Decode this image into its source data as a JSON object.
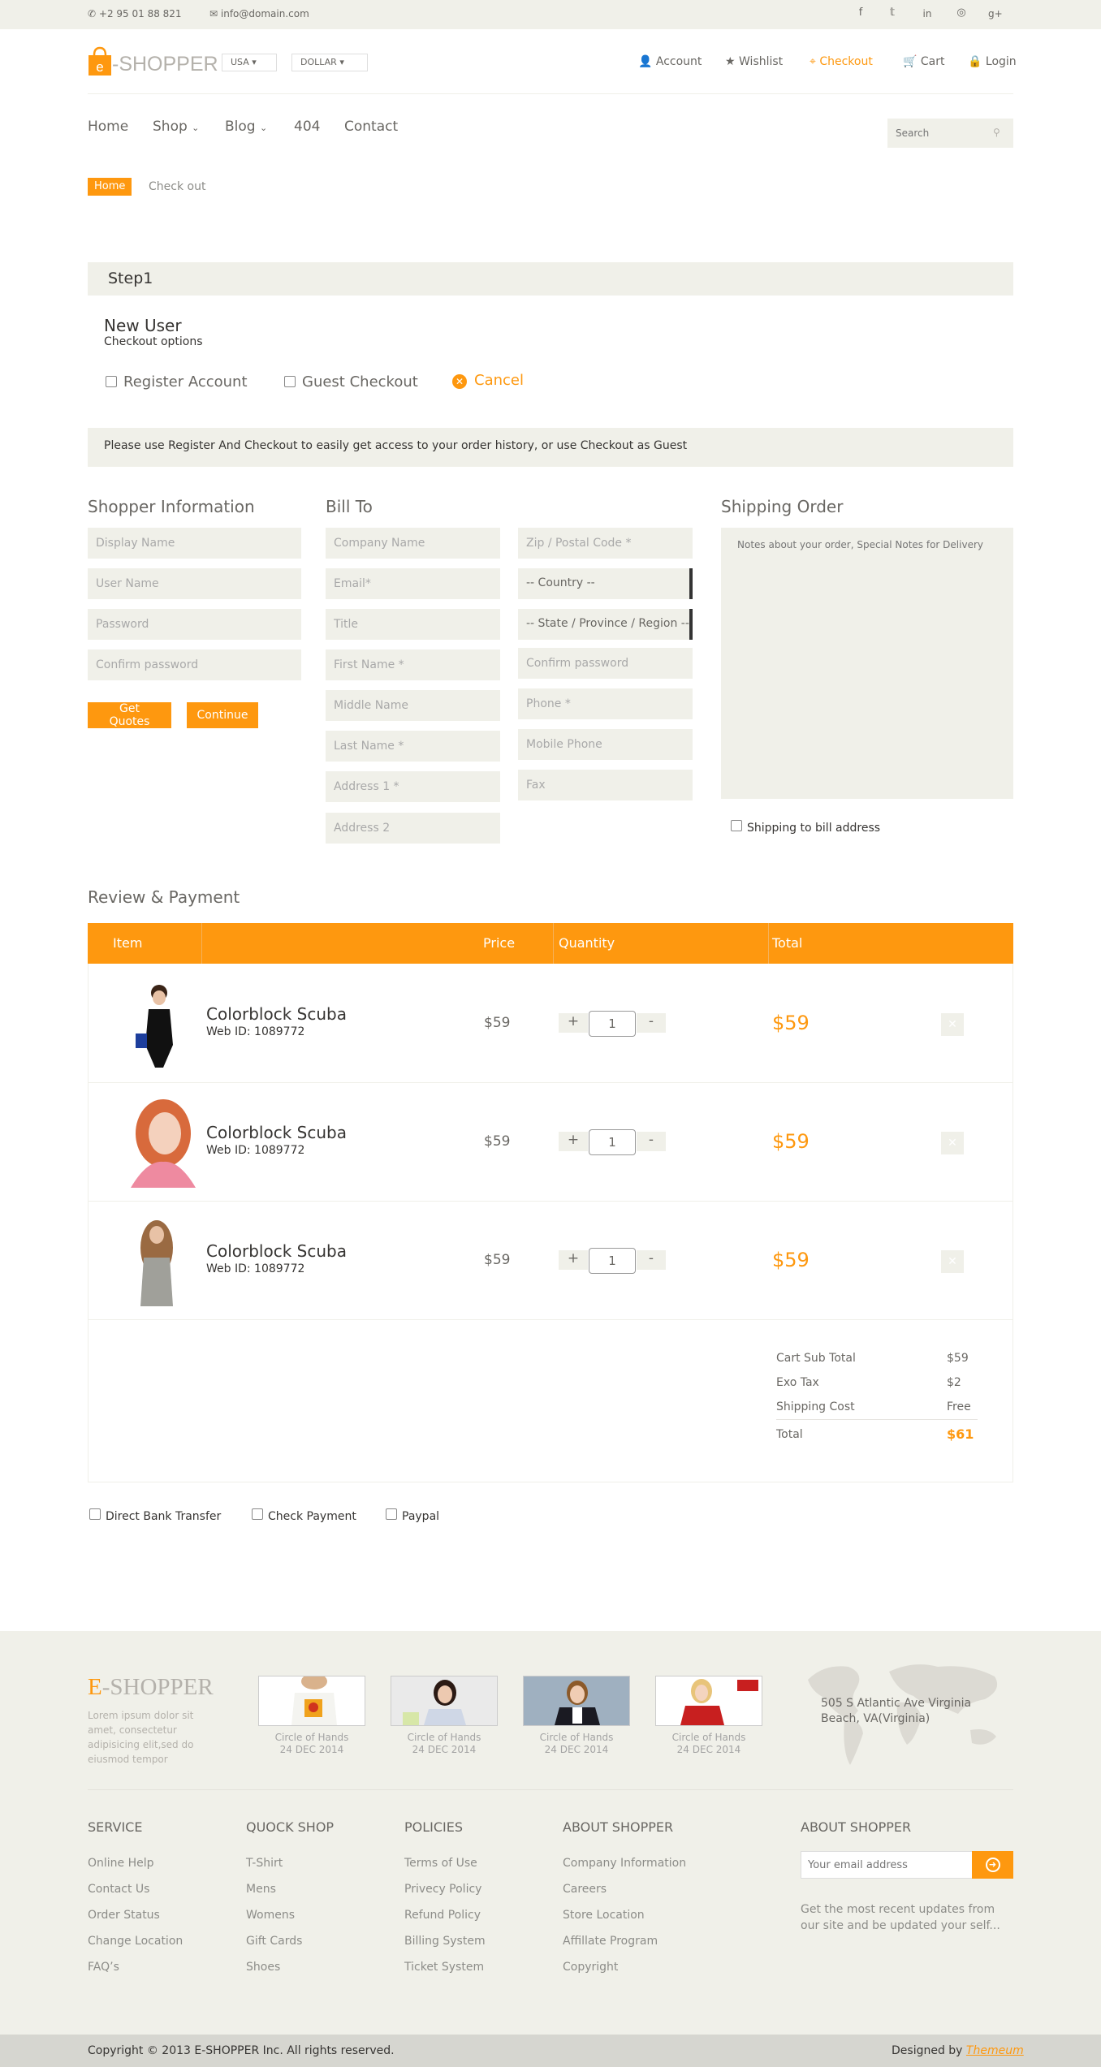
{
  "topbar": {
    "phone": "+2 95 01 88 821",
    "email": "info@domain.com",
    "social": [
      "facebook-icon",
      "twitter-icon",
      "linkedin-icon",
      "dribbble-icon",
      "google-plus-icon"
    ]
  },
  "header": {
    "logo_e": "e",
    "logo_text": "-SHOPPER",
    "country_dropdown": "USA",
    "currency_dropdown": "DOLLAR",
    "nav": [
      "Account",
      "Wishlist",
      "Checkout",
      "Cart",
      "Login"
    ]
  },
  "mainnav": {
    "items": [
      "Home",
      "Shop",
      "Blog",
      "404",
      "Contact"
    ],
    "search_placeholder": "Search"
  },
  "breadcrumb": {
    "home": "Home",
    "current": "Check out"
  },
  "step": {
    "title": "Step1",
    "heading": "New User",
    "sub": "Checkout options",
    "register": "Register Account",
    "guest": "Guest Checkout",
    "cancel": "Cancel"
  },
  "notice": "Please use Register And Checkout to easily get access to your order history, or use Checkout as Guest",
  "shopper": {
    "title": "Shopper Information",
    "fields": [
      "Display Name",
      "User Name",
      "Password",
      "Confirm password"
    ],
    "quotes_btn": "Get Quotes",
    "continue_btn": "Continue"
  },
  "billto": {
    "title": "Bill To",
    "col1": [
      "Company Name",
      "Email*",
      "Title",
      "First Name *",
      "Middle Name",
      "Last Name *",
      "Address 1 *",
      "Address 2"
    ],
    "zip": "Zip / Postal Code *",
    "country": "-- Country --",
    "state": "-- State / Province / Region --",
    "col2": [
      "Confirm password",
      "Phone *",
      "Mobile Phone",
      "Fax"
    ]
  },
  "shipping": {
    "title": "Shipping Order",
    "placeholder": "Notes about your order, Special Notes for Delivery",
    "checkbox": "Shipping to bill address"
  },
  "review": {
    "title": "Review & Payment",
    "headers": [
      "Item",
      "",
      "Price",
      "Quantity",
      "Total"
    ],
    "items": [
      {
        "name": "Colorblock Scuba",
        "web_id": "Web ID: 1089772",
        "price": "$59",
        "qty": "1",
        "total": "$59"
      },
      {
        "name": "Colorblock Scuba",
        "web_id": "Web ID: 1089772",
        "price": "$59",
        "qty": "1",
        "total": "$59"
      },
      {
        "name": "Colorblock Scuba",
        "web_id": "Web ID: 1089772",
        "price": "$59",
        "qty": "1",
        "total": "$59"
      }
    ],
    "plus": "+",
    "minus": "-",
    "summary": [
      {
        "label": "Cart Sub Total",
        "value": "$59"
      },
      {
        "label": "Exo Tax",
        "value": "$2"
      },
      {
        "label": "Shipping Cost",
        "value": "Free"
      },
      {
        "label": "Total",
        "value": "$61"
      }
    ]
  },
  "payment": [
    "Direct Bank Transfer",
    "Check Payment",
    "Paypal"
  ],
  "footer": {
    "logo_e": "E",
    "logo_text": "-SHOPPER",
    "lorem": "Lorem ipsum dolor sit amet, consectetur adipisicing elit,sed do eiusmod tempor",
    "videos": [
      {
        "cap": "Circle of Hands",
        "date": "24 DEC 2014"
      },
      {
        "cap": "Circle of Hands",
        "date": "24 DEC 2014"
      },
      {
        "cap": "Circle of Hands",
        "date": "24 DEC 2014"
      },
      {
        "cap": "Circle of Hands",
        "date": "24 DEC 2014"
      }
    ],
    "address": "505 S Atlantic Ave Virginia Beach, VA(Virginia)",
    "service": {
      "title": "Service",
      "links": [
        "Online Help",
        "Contact Us",
        "Order Status",
        "Change Location",
        "FAQ’s"
      ]
    },
    "quock": {
      "title": "Quock Shop",
      "links": [
        "T-Shirt",
        "Mens",
        "Womens",
        "Gift Cards",
        "Shoes"
      ]
    },
    "policies": {
      "title": "Policies",
      "links": [
        "Terms of Use",
        "Privecy Policy",
        "Refund Policy",
        "Billing System",
        "Ticket System"
      ]
    },
    "about": {
      "title": "About Shopper",
      "links": [
        "Company Information",
        "Careers",
        "Store Location",
        "Affillate Program",
        "Copyright"
      ]
    },
    "subscribe": {
      "title": "About Shopper",
      "placeholder": "Your email address",
      "text": "Get the most recent updates from our site and be updated your self..."
    }
  },
  "bottom": {
    "copyright": "Copyright © 2013 E-SHOPPER Inc. All rights reserved.",
    "designed": "Designed by",
    "designer": "Themeum"
  },
  "colors": {
    "accent": "#fe980f",
    "panel": "#f0f0e9",
    "text": "#696763"
  }
}
